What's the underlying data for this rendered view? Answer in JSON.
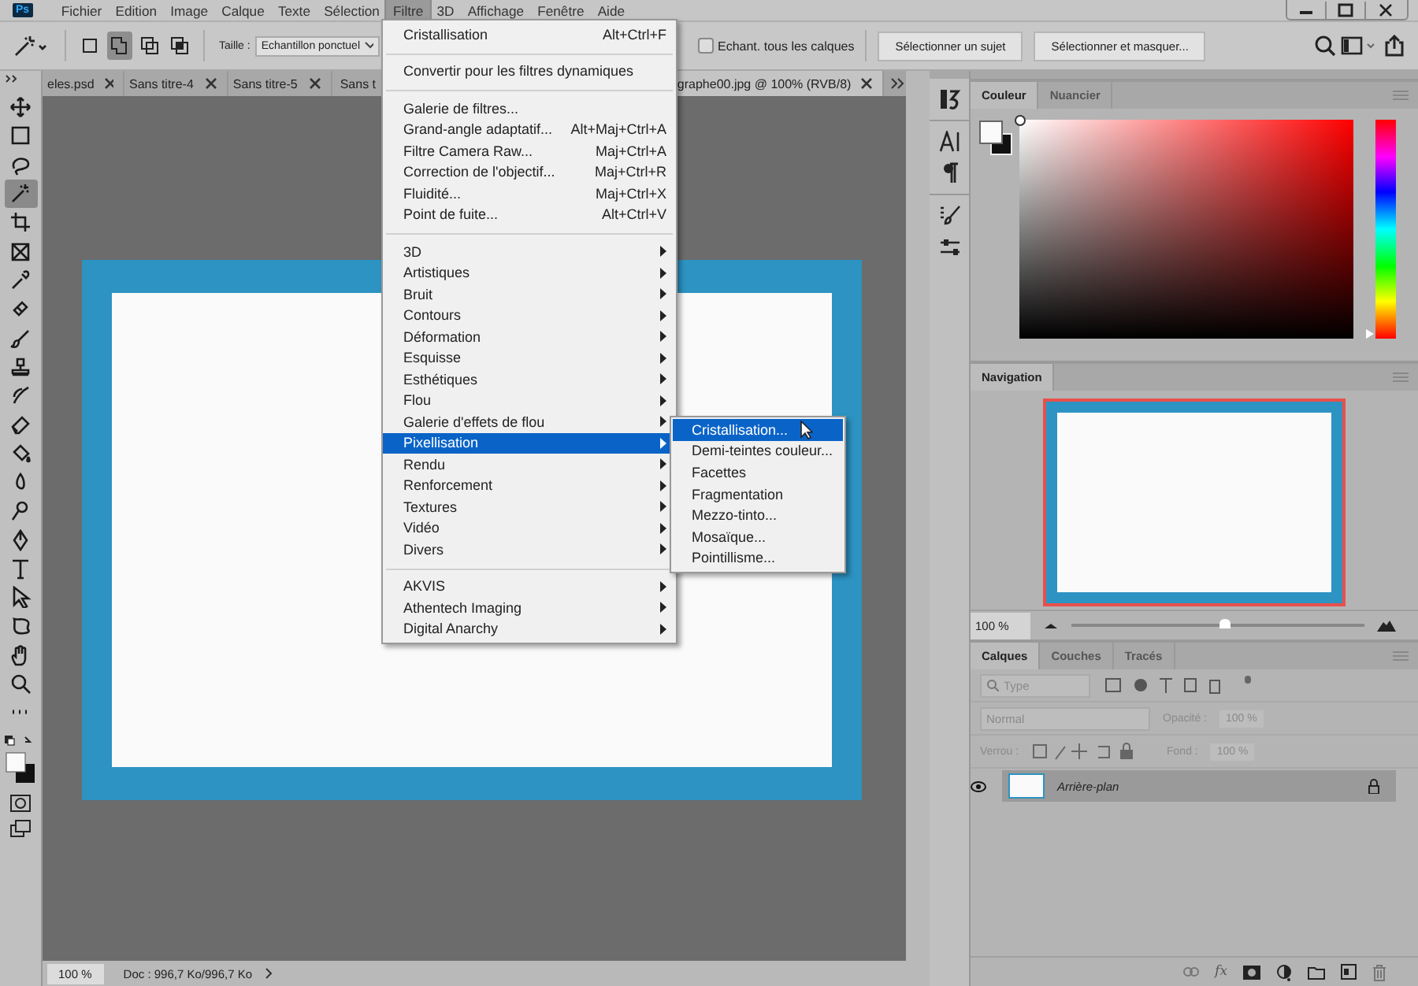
{
  "app_icon": "Ps",
  "menu_bar": [
    {
      "label": "Fichier",
      "selected": false
    },
    {
      "label": "Edition",
      "selected": false
    },
    {
      "label": "Image",
      "selected": false
    },
    {
      "label": "Calque",
      "selected": false
    },
    {
      "label": "Texte",
      "selected": false
    },
    {
      "label": "Sélection",
      "selected": false
    },
    {
      "label": "Filtre",
      "selected": true
    },
    {
      "label": "3D",
      "selected": false
    },
    {
      "label": "Affichage",
      "selected": false
    },
    {
      "label": "Fenêtre",
      "selected": false
    },
    {
      "label": "Aide",
      "selected": false
    }
  ],
  "options_bar": {
    "selection_modes": [
      {
        "selected": false
      },
      {
        "selected": true
      },
      {
        "selected": false
      },
      {
        "selected": false
      }
    ],
    "size_label": "Taille :",
    "size_value": "Echantillon ponctuel",
    "sample_all": {
      "label": "Echant. tous les calques",
      "checked": false
    },
    "buttons": [
      "Sélectionner un sujet",
      "Sélectionner et masquer..."
    ]
  },
  "document_tabs": [
    {
      "label": "eles.psd",
      "selected": false
    },
    {
      "label": "Sans titre-4",
      "selected": false
    },
    {
      "label": "Sans titre-5",
      "selected": false
    },
    {
      "label": "Sans t",
      "selected": false
    },
    {
      "label": "graphe00.jpg @ 100% (RVB/8)",
      "selected": true
    }
  ],
  "tools": [
    {
      "kind": "move",
      "selected": false
    },
    {
      "kind": "marquee",
      "selected": false
    },
    {
      "kind": "lasso",
      "selected": false
    },
    {
      "kind": "wand",
      "selected": true
    },
    {
      "kind": "crop",
      "selected": false
    },
    {
      "kind": "frame",
      "selected": false
    },
    {
      "kind": "eyedropper",
      "selected": false
    },
    {
      "kind": "healing",
      "selected": false
    },
    {
      "kind": "brush",
      "selected": false
    },
    {
      "kind": "stamp",
      "selected": false
    },
    {
      "kind": "history",
      "selected": false
    },
    {
      "kind": "eraser",
      "selected": false
    },
    {
      "kind": "bucket",
      "selected": false
    },
    {
      "kind": "blur",
      "selected": false
    },
    {
      "kind": "dodge",
      "selected": false
    },
    {
      "kind": "pen",
      "selected": false
    },
    {
      "kind": "type",
      "selected": false
    },
    {
      "kind": "pointer",
      "selected": false
    },
    {
      "kind": "shape",
      "selected": false
    },
    {
      "kind": "hand",
      "selected": false
    },
    {
      "kind": "zoom",
      "selected": false
    },
    {
      "kind": "more",
      "selected": false
    }
  ],
  "filter_menu": [
    {
      "kind": "item",
      "label": "Cristallisation",
      "shortcut": "Alt+Ctrl+F"
    },
    {
      "kind": "separator"
    },
    {
      "kind": "item",
      "label": "Convertir pour les filtres dynamiques"
    },
    {
      "kind": "separator"
    },
    {
      "kind": "item",
      "label": "Galerie de filtres..."
    },
    {
      "kind": "item",
      "label": "Grand-angle adaptatif...",
      "shortcut": "Alt+Maj+Ctrl+A"
    },
    {
      "kind": "item",
      "label": "Filtre Camera Raw...",
      "shortcut": "Maj+Ctrl+A"
    },
    {
      "kind": "item",
      "label": "Correction de l'objectif...",
      "shortcut": "Maj+Ctrl+R"
    },
    {
      "kind": "item",
      "label": "Fluidité...",
      "shortcut": "Maj+Ctrl+X"
    },
    {
      "kind": "item",
      "label": "Point de fuite...",
      "shortcut": "Alt+Ctrl+V"
    },
    {
      "kind": "separator"
    },
    {
      "kind": "submenu",
      "label": "3D",
      "selected": false
    },
    {
      "kind": "submenu",
      "label": "Artistiques",
      "selected": false
    },
    {
      "kind": "submenu",
      "label": "Bruit",
      "selected": false
    },
    {
      "kind": "submenu",
      "label": "Contours",
      "selected": false
    },
    {
      "kind": "submenu",
      "label": "Déformation",
      "selected": false
    },
    {
      "kind": "submenu",
      "label": "Esquisse",
      "selected": false
    },
    {
      "kind": "submenu",
      "label": "Esthétiques",
      "selected": false
    },
    {
      "kind": "submenu",
      "label": "Flou",
      "selected": false
    },
    {
      "kind": "submenu",
      "label": "Galerie d'effets de flou",
      "selected": false
    },
    {
      "kind": "submenu",
      "label": "Pixellisation",
      "selected": true
    },
    {
      "kind": "submenu",
      "label": "Rendu",
      "selected": false
    },
    {
      "kind": "submenu",
      "label": "Renforcement",
      "selected": false
    },
    {
      "kind": "submenu",
      "label": "Textures",
      "selected": false
    },
    {
      "kind": "submenu",
      "label": "Vidéo",
      "selected": false
    },
    {
      "kind": "submenu",
      "label": "Divers",
      "selected": false
    },
    {
      "kind": "separator"
    },
    {
      "kind": "submenu",
      "label": "AKVIS",
      "selected": false
    },
    {
      "kind": "submenu",
      "label": "Athentech Imaging",
      "selected": false
    },
    {
      "kind": "submenu",
      "label": "Digital Anarchy",
      "selected": false
    }
  ],
  "pixel_submenu": [
    {
      "label": "Cristallisation...",
      "selected": true
    },
    {
      "label": "Demi-teintes couleur...",
      "selected": false
    },
    {
      "label": "Facettes",
      "selected": false
    },
    {
      "label": "Fragmentation",
      "selected": false
    },
    {
      "label": "Mezzo-tinto...",
      "selected": false
    },
    {
      "label": "Mosaïque...",
      "selected": false
    },
    {
      "label": "Pointillisme...",
      "selected": false
    }
  ],
  "status_bar": {
    "zoom": "100 %",
    "doc": "Doc : 996,7 Ko/996,7 Ko"
  },
  "color_panel": {
    "tabs": [
      {
        "label": "Couleur",
        "selected": true
      },
      {
        "label": "Nuancier",
        "selected": false
      }
    ],
    "hue": {
      "level": 0
    }
  },
  "navigation": {
    "tab": "Navigation",
    "zoom": "100 %",
    "level": 0.52
  },
  "layers": {
    "tabs": [
      {
        "label": "Calques",
        "selected": true
      },
      {
        "label": "Couches",
        "selected": false
      },
      {
        "label": "Tracés",
        "selected": false
      }
    ],
    "filter": "Type",
    "blend_mode": "Normal",
    "opacity_label": "Opacité :",
    "opacity": "100 %",
    "lock_label": "Verrou :",
    "fill_label": "Fond :",
    "fill": "100 %",
    "options_disabled": true,
    "fx": "fx",
    "items": [
      {
        "name": "Arrière-plan",
        "visible": true,
        "locked": true,
        "selected": true
      }
    ]
  }
}
